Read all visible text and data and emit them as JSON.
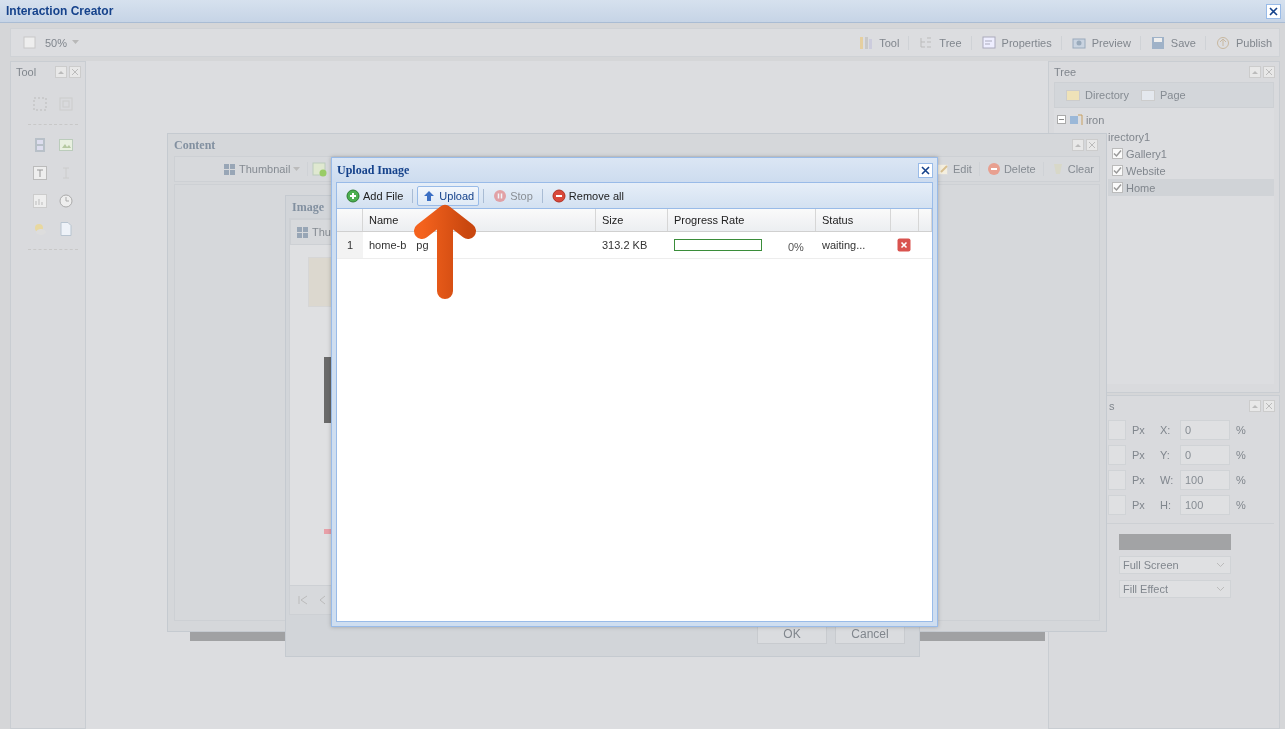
{
  "window": {
    "title": "Interaction Creator"
  },
  "toolbar": {
    "zoom": "50%",
    "buttons": [
      {
        "kind": "tool",
        "label": "Tool"
      },
      {
        "kind": "tree",
        "label": "Tree"
      },
      {
        "kind": "properties",
        "label": "Properties"
      },
      {
        "kind": "preview",
        "label": "Preview"
      },
      {
        "kind": "save",
        "label": "Save"
      },
      {
        "kind": "publish",
        "label": "Publish"
      }
    ]
  },
  "tool_panel": {
    "title": "Tool"
  },
  "tree_panel": {
    "title": "Tree",
    "buttons": [
      "Directory",
      "Page"
    ],
    "nodes": [
      {
        "label": "iron",
        "expanded": true,
        "children": [
          {
            "label": "irectory1",
            "children": [
              {
                "label": "Gallery1",
                "checked": true,
                "selected": false
              },
              {
                "label": "Website",
                "checked": true,
                "selected": false
              },
              {
                "label": "Home",
                "checked": true,
                "selected": true
              }
            ]
          }
        ]
      }
    ]
  },
  "properties_panel": {
    "title": "s",
    "rows": [
      {
        "unit": "Px",
        "axis": "X:",
        "value": "0",
        "percent": "%"
      },
      {
        "unit": "Px",
        "axis": "Y:",
        "value": "0",
        "percent": "%"
      },
      {
        "unit": "Px",
        "axis": "W:",
        "value": "100",
        "percent": "%"
      },
      {
        "unit": "Px",
        "axis": "H:",
        "value": "100",
        "percent": "%"
      }
    ],
    "selects": [
      "Full Screen",
      "Fill Effect"
    ]
  },
  "content_window": {
    "title": "Content",
    "view": "Thumbnail",
    "buttons": [
      {
        "kind": "edit",
        "label": "Edit"
      },
      {
        "kind": "delete",
        "label": "Delete"
      },
      {
        "kind": "clear",
        "label": "Clear"
      }
    ]
  },
  "image_window": {
    "title": "Image",
    "view": "Thu",
    "buttons": [
      "OK",
      "Cancel"
    ]
  },
  "upload_dialog": {
    "title": "Upload Image",
    "toolbar": [
      {
        "kind": "add",
        "label": "Add File",
        "selected": false,
        "disabled": false
      },
      {
        "kind": "upload",
        "label": "Upload",
        "selected": true,
        "disabled": false
      },
      {
        "kind": "stop",
        "label": "Stop",
        "selected": false,
        "disabled": true
      },
      {
        "kind": "remove",
        "label": "Remove all",
        "selected": false,
        "disabled": false
      }
    ],
    "columns": [
      "Name",
      "Size",
      "Progress Rate",
      "Status"
    ],
    "rows": [
      {
        "number": "1",
        "name": [
          "home-b",
          "pg"
        ],
        "size": "313.2 KB",
        "level": 0,
        "progress": "0%",
        "status": "waiting..."
      }
    ]
  }
}
